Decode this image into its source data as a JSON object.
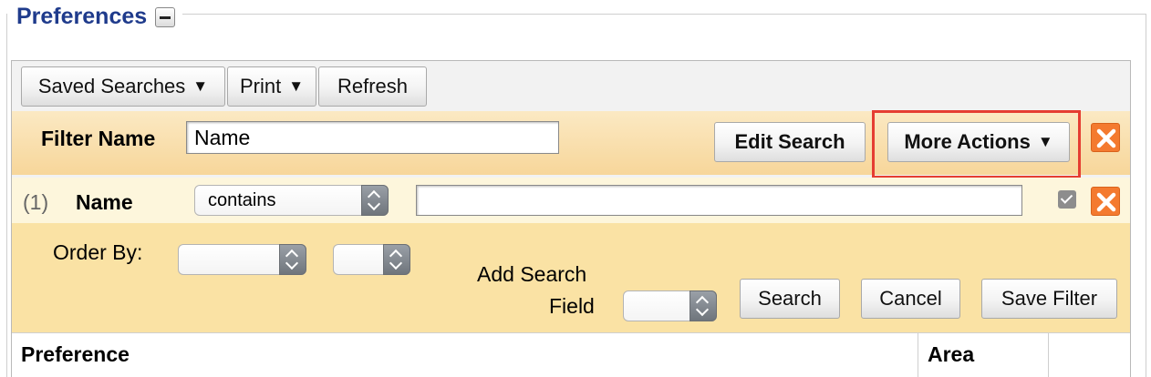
{
  "legend": {
    "title": "Preferences"
  },
  "toolbar": {
    "saved_searches": "Saved Searches",
    "print": "Print",
    "refresh": "Refresh",
    "dropdown_glyph": "▼"
  },
  "filter": {
    "label": "Filter Name",
    "value": "Name",
    "edit_search": "Edit Search",
    "more_actions": "More Actions"
  },
  "criteria": {
    "index": "(1)",
    "field": "Name",
    "operator": "contains",
    "value": "",
    "checked": true
  },
  "order": {
    "label": "Order By:",
    "add_field_label_line1": "Add Search",
    "add_field_label_line2": "Field",
    "search": "Search",
    "cancel": "Cancel",
    "save_filter": "Save Filter"
  },
  "table": {
    "columns": [
      "Preference",
      "Area",
      ""
    ]
  },
  "colors": {
    "legend": "#1f3b8c",
    "highlight": "#e53d32",
    "remove": "#f47a2f",
    "filter_bar": "#f7d69a",
    "order_area": "#fae2a4"
  },
  "icons": {
    "collapse": "minus-box-icon",
    "remove": "close-x-icon",
    "select": "updown-chevron-icon",
    "dropdown": "caret-down-icon"
  }
}
